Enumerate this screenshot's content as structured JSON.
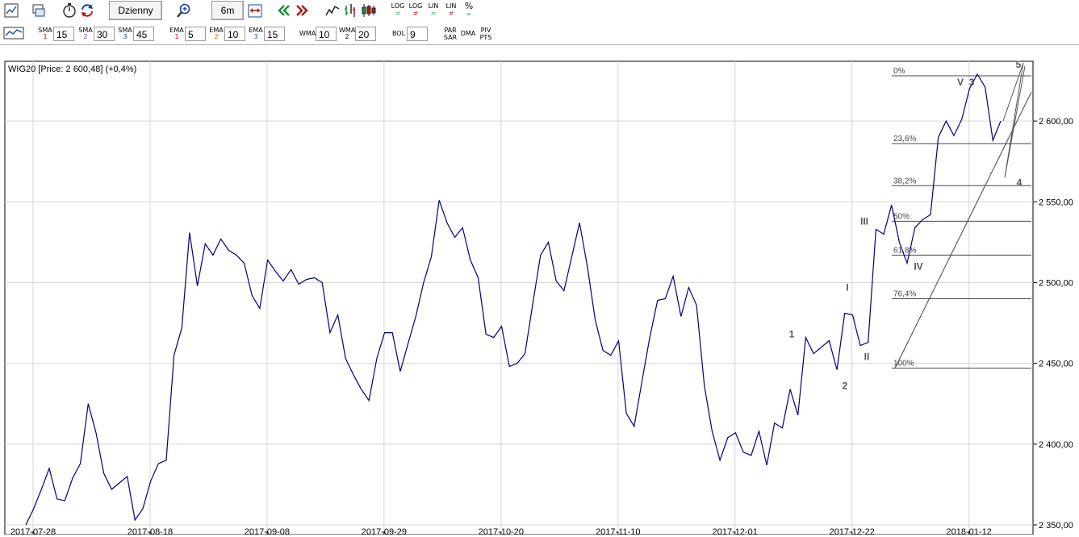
{
  "toolbar": {
    "interval_label": "Dzienny",
    "range_label": "6m",
    "scale_buttons": [
      {
        "top": "LOG",
        "bottom": "="
      },
      {
        "top": "LOG",
        "bottom": "≠"
      },
      {
        "top": "LIN",
        "bottom": "="
      },
      {
        "top": "LIN",
        "bottom": "≠"
      },
      {
        "top": "%",
        "bottom": "="
      }
    ],
    "prev_icon": "double-chevron-left-icon",
    "next_icon": "double-chevron-right-icon",
    "colors": {
      "green": "#1a8c3a",
      "red": "#b01515",
      "blue": "#1a3fa0"
    }
  },
  "indicators": {
    "sma": [
      {
        "label": "SMA",
        "num": "1",
        "value": "15"
      },
      {
        "label": "SMA",
        "num": "2",
        "value": "30"
      },
      {
        "label": "SMA",
        "num": "3",
        "value": "45"
      }
    ],
    "ema": [
      {
        "label": "EMA",
        "num": "1",
        "value": "5"
      },
      {
        "label": "EMA",
        "num": "2",
        "value": "10"
      },
      {
        "label": "EMA",
        "num": "3",
        "value": "15"
      }
    ],
    "wma": [
      {
        "label": "WMA",
        "num": "",
        "value": "10"
      },
      {
        "label": "WMA",
        "num": "2",
        "value": "20"
      }
    ],
    "bol": {
      "label": "BOL",
      "value": "9"
    },
    "par_sar": {
      "top": "PAR",
      "bottom": "SAR"
    },
    "dma": "DMA",
    "piv_pts": {
      "top": "PIV",
      "bottom": "PTS"
    },
    "num_colors": {
      "1": "#cc0000",
      "2": "#7a3fb0",
      "3": "#1a3fa0",
      "ema1": "#cc0000",
      "ema2": "#d07000",
      "ema3": "#1a3fa0"
    }
  },
  "chart_data": {
    "type": "line",
    "title": "WIG20 [Price: 2 600,48] (+0,4%)",
    "line_color": "#00007a",
    "x_ticks": [
      "2017-07-28",
      "2017-08-18",
      "2017-09-08",
      "2017-09-29",
      "2017-10-20",
      "2017-11-10",
      "2017-12-01",
      "2017-12-22",
      "2018-01-12"
    ],
    "y_ticks": [
      "2 350,00",
      "2 400,00",
      "2 450,00",
      "2 500,00",
      "2 550,00",
      "2 600,00"
    ],
    "y_tick_values": [
      2350,
      2400,
      2450,
      2500,
      2550,
      2600
    ],
    "ylim": [
      2345,
      2637
    ],
    "grid": true,
    "series": [
      {
        "values": [
          2350,
          2360,
          2372,
          2385,
          2366,
          2365,
          2379,
          2388,
          2425,
          2407,
          2382,
          2372,
          2376,
          2380,
          2353,
          2360,
          2377,
          2388,
          2390,
          2455,
          2472,
          2531,
          2498,
          2524,
          2517,
          2527,
          2520,
          2517,
          2512,
          2492,
          2484,
          2514,
          2507,
          2501,
          2508,
          2499,
          2502,
          2503,
          2500,
          2469,
          2480,
          2453,
          2443,
          2434,
          2427,
          2453,
          2469,
          2469,
          2445,
          2462,
          2479,
          2500,
          2516,
          2551,
          2537,
          2528,
          2534,
          2514,
          2503,
          2468,
          2466,
          2473,
          2448,
          2450,
          2456,
          2487,
          2517,
          2525,
          2501,
          2495,
          2516,
          2537,
          2510,
          2477,
          2458,
          2455,
          2464,
          2419,
          2411,
          2439,
          2466,
          2489,
          2490,
          2504,
          2479,
          2497,
          2486,
          2436,
          2408,
          2390,
          2404,
          2407,
          2395,
          2393,
          2408,
          2387,
          2413,
          2410,
          2434,
          2418,
          2466,
          2456,
          2460,
          2464,
          2446,
          2481,
          2480,
          2461,
          2463,
          2533,
          2530,
          2548,
          2525,
          2512,
          2534,
          2539,
          2542,
          2590,
          2600,
          2591,
          2601,
          2620,
          2629,
          2621,
          2588,
          2600
        ]
      }
    ],
    "fibonacci": [
      {
        "label": "0%",
        "value": 2628
      },
      {
        "label": "23,6%",
        "value": 2586
      },
      {
        "label": "38,2%",
        "value": 2560
      },
      {
        "label": "50%",
        "value": 2538
      },
      {
        "label": "61,8%",
        "value": 2517
      },
      {
        "label": "76,4%",
        "value": 2490
      },
      {
        "label": "100%",
        "value": 2447
      }
    ],
    "wave_labels": [
      "1",
      "2",
      "I",
      "II",
      "III",
      "IV",
      "V",
      "3",
      "4",
      "5"
    ]
  }
}
